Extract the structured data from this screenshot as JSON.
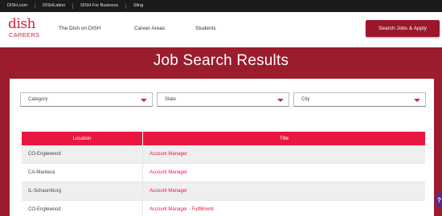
{
  "topbar": {
    "links": [
      "DISH.com",
      "DISHLatino",
      "DISH For Business",
      "Sling"
    ]
  },
  "logo": {
    "dish": "dish",
    "careers": "CAREERS"
  },
  "nav": {
    "items": [
      "The Dish on DISH",
      "Career Areas",
      "Students"
    ]
  },
  "cta": {
    "label": "Search Jobs & Apply"
  },
  "hero": {
    "title": "Job Search Results"
  },
  "filters": {
    "category": "Category",
    "state": "State",
    "city": "City"
  },
  "table": {
    "headers": {
      "location": "Location",
      "title": "Title"
    },
    "rows": [
      {
        "location": "CO-Englewood",
        "title": "Account Manager"
      },
      {
        "location": "CA-Manteca",
        "title": "Account Manager"
      },
      {
        "location": "IL-Schaumburg",
        "title": "Account Manager"
      },
      {
        "location": "CO-Englewood",
        "title": "Account Manager - Fulfillment"
      }
    ]
  },
  "help": {
    "label": "?"
  },
  "colors": {
    "brand_red": "#d4213d",
    "hero_bg": "#9b1c2c",
    "table_header": "#e8173f",
    "cta_bg": "#9a1629"
  }
}
